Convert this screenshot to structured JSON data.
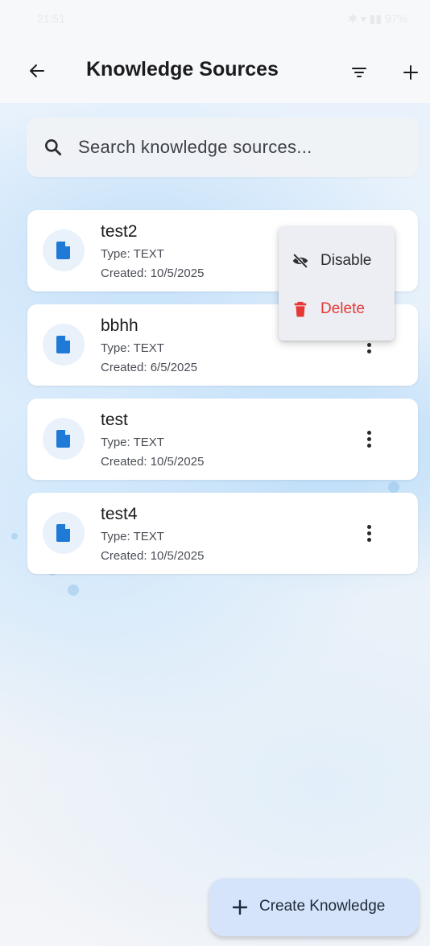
{
  "status_bar": {
    "time": "21:51",
    "indicators": "✱  ▾  ▮▮  97%"
  },
  "app_bar": {
    "title": "Knowledge Sources",
    "back_icon": "arrow-left-icon",
    "filter_icon": "filter-icon",
    "add_icon": "plus-icon"
  },
  "search": {
    "placeholder": "Search knowledge sources...",
    "value": ""
  },
  "items": [
    {
      "name": "test2",
      "type": "Type: TEXT",
      "created": "Created: 10/5/2025"
    },
    {
      "name": "bbhh",
      "type": "Type: TEXT",
      "created": "Created: 6/5/2025"
    },
    {
      "name": "test",
      "type": "Type: TEXT",
      "created": "Created: 10/5/2025"
    },
    {
      "name": "test4",
      "type": "Type: TEXT",
      "created": "Created: 10/5/2025"
    }
  ],
  "context_menu": {
    "disable": {
      "label": "Disable",
      "icon": "eye-off-icon",
      "color": "#2b2d31"
    },
    "delete": {
      "label": "Delete",
      "icon": "trash-icon",
      "color": "#e53935"
    }
  },
  "fab": {
    "label": "Create Knowledge",
    "icon": "plus-icon"
  },
  "colors": {
    "accent": "#1e7ad6",
    "danger": "#e53935"
  }
}
